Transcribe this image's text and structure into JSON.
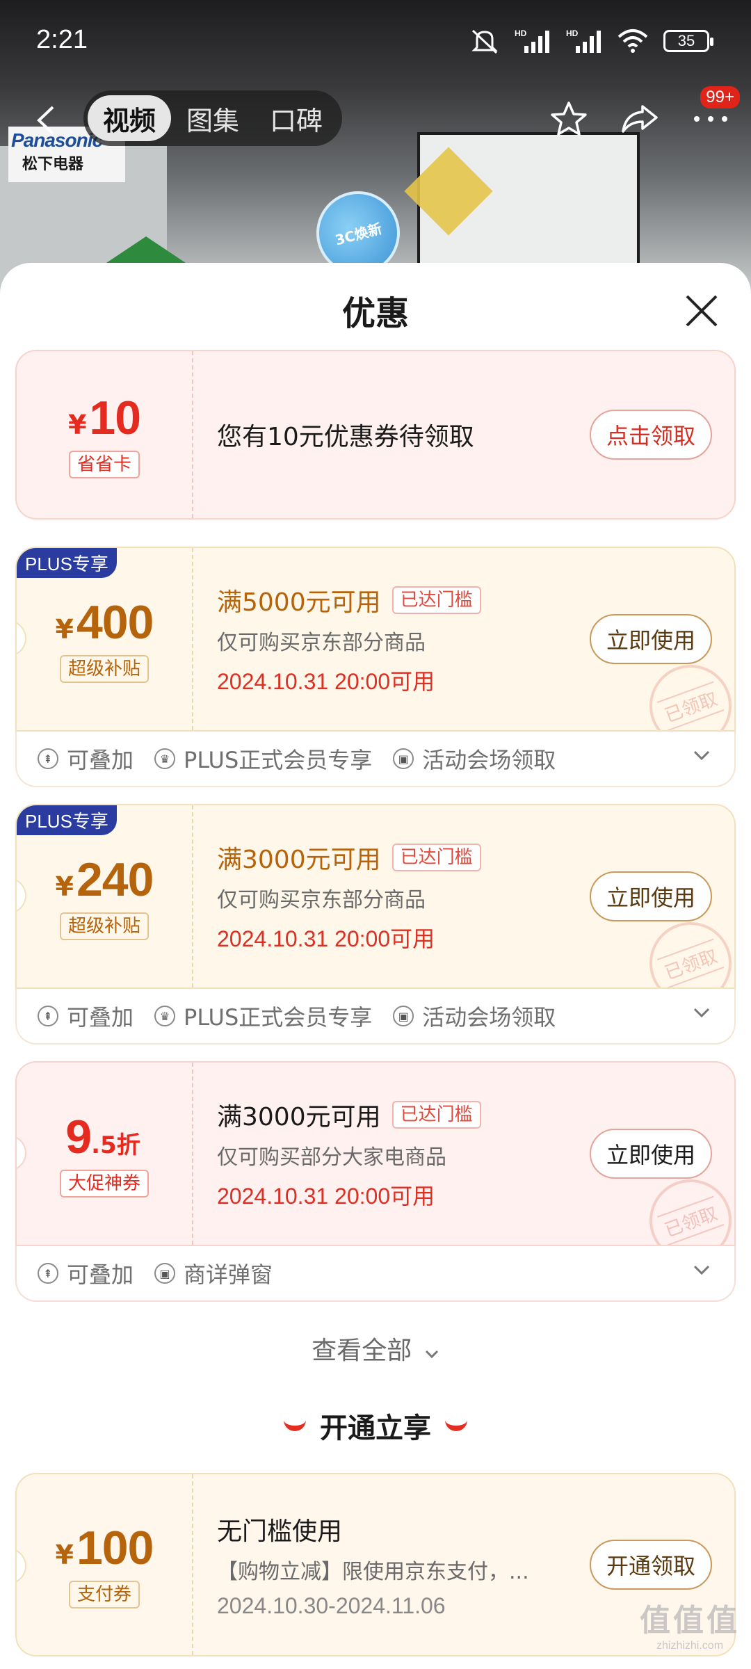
{
  "status": {
    "time": "2:21",
    "battery": "35"
  },
  "nav": {
    "tabs": [
      "视频",
      "图集",
      "口碑"
    ],
    "badge": "99+"
  },
  "background": {
    "brand_en": "Panasonic",
    "brand_cn": "松下电器",
    "promo_circle": "3C焕新"
  },
  "sheet": {
    "title": "优惠"
  },
  "coupons": [
    {
      "amount": "10",
      "currency": "¥",
      "tag": "省省卡",
      "text": "您有10元优惠券待领取",
      "action": "点击领取"
    },
    {
      "plus_badge": "PLUS专享",
      "amount": "400",
      "currency": "¥",
      "tag": "超级补贴",
      "condition": "满5000元可用",
      "reached": "已达门槛",
      "scope": "仅可购买京东部分商品",
      "date": "2024.10.31 20:00可用",
      "action": "立即使用",
      "stamp": "已领取",
      "meta": [
        "可叠加",
        "PLUS正式会员专享",
        "活动会场领取"
      ]
    },
    {
      "plus_badge": "PLUS专享",
      "amount": "240",
      "currency": "¥",
      "tag": "超级补贴",
      "condition": "满3000元可用",
      "reached": "已达门槛",
      "scope": "仅可购买京东部分商品",
      "date": "2024.10.31 20:00可用",
      "action": "立即使用",
      "stamp": "已领取",
      "meta": [
        "可叠加",
        "PLUS正式会员专享",
        "活动会场领取"
      ]
    },
    {
      "amount_int": "9",
      "amount_dec": ".5折",
      "tag": "大促神券",
      "condition": "满3000元可用",
      "reached": "已达门槛",
      "scope": "仅可购买部分大家电商品",
      "date": "2024.10.31 20:00可用",
      "action": "立即使用",
      "stamp": "已领取",
      "meta": [
        "可叠加",
        "商详弹窗"
      ]
    }
  ],
  "view_all": "查看全部",
  "section2": {
    "title": "开通立享"
  },
  "pay_coupon": {
    "amount": "100",
    "currency": "¥",
    "tag": "支付券",
    "condition": "无门槛使用",
    "scope": "【购物立减】限使用京东支付，...",
    "date": "2024.10.30-2024.11.06",
    "action": "开通领取"
  },
  "watermark": {
    "big": "值值值",
    "small": "zhizhizhi.com"
  },
  "colors": {
    "accent_red": "#e52b1f",
    "plus_blue": "#2a3ca0",
    "gold_brown": "#b5640c"
  }
}
